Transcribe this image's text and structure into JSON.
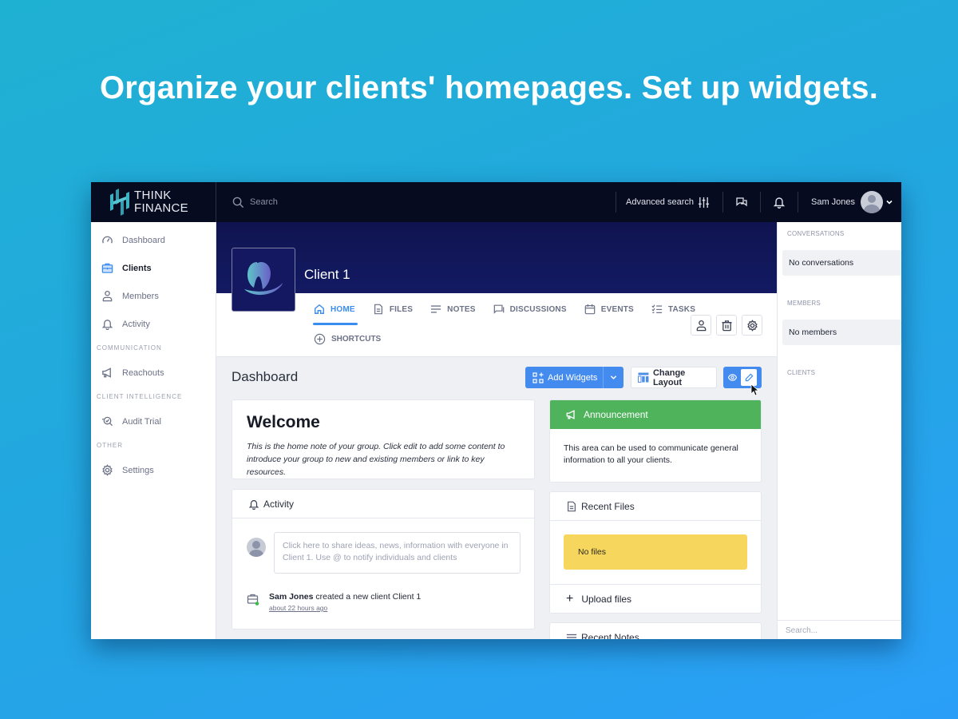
{
  "headline": "Organize your clients' homepages. Set up widgets.",
  "topbar": {
    "brand_line1": "THINK",
    "brand_line2": "FINANCE",
    "search_placeholder": "Search",
    "advanced_search_label": "Advanced search",
    "user_name": "Sam Jones",
    "icons": [
      "sliders-icon",
      "chat-icon",
      "bell-icon",
      "avatar",
      "chevron-down-icon"
    ]
  },
  "sidebar": {
    "items": [
      {
        "label": "Dashboard",
        "icon": "speedometer-icon",
        "active": false
      },
      {
        "label": "Clients",
        "icon": "briefcase-icon",
        "active": true
      },
      {
        "label": "Members",
        "icon": "user-icon",
        "active": false
      },
      {
        "label": "Activity",
        "icon": "bell-icon",
        "active": false
      }
    ],
    "sections": [
      {
        "title": "COMMUNICATION",
        "items": [
          {
            "label": "Reachouts",
            "icon": "megaphone-icon"
          }
        ]
      },
      {
        "title": "CLIENT INTELLIGENCE",
        "items": [
          {
            "label": "Audit Trial",
            "icon": "audit-search-icon"
          }
        ]
      },
      {
        "title": "OTHER",
        "items": [
          {
            "label": "Settings",
            "icon": "gear-icon"
          }
        ]
      }
    ]
  },
  "client": {
    "name": "Client 1",
    "tabs": [
      {
        "label": "HOME",
        "icon": "home-icon",
        "active": true
      },
      {
        "label": "FILES",
        "icon": "file-icon",
        "active": false
      },
      {
        "label": "NOTES",
        "icon": "notes-icon",
        "active": false
      },
      {
        "label": "DISCUSSIONS",
        "icon": "discussion-icon",
        "active": false
      },
      {
        "label": "EVENTS",
        "icon": "calendar-icon",
        "active": false
      },
      {
        "label": "TASKS",
        "icon": "tasks-icon",
        "active": false
      }
    ],
    "shortcuts_label": "SHORTCUTS"
  },
  "dashboard": {
    "title": "Dashboard",
    "add_widgets_label": "Add Widgets",
    "change_layout_label": "Change Layout"
  },
  "welcome": {
    "title": "Welcome",
    "body": "This is the home note of your group. Click edit to add some content to introduce your group to new and existing members or link to key resources."
  },
  "activity": {
    "title": "Activity",
    "input_placeholder": "Click here to share ideas, news, information with everyone in Client 1. Use @ to notify individuals and clients",
    "feed": [
      {
        "actor": "Sam Jones",
        "action": " created a new client Client 1",
        "time": "about 22 hours ago"
      }
    ]
  },
  "announcement": {
    "title": "Announcement",
    "body": "This area can be used to communicate general information to all your clients.",
    "color": "#4fb35c"
  },
  "recent_files": {
    "title": "Recent Files",
    "empty_label": "No files",
    "upload_label": "Upload files"
  },
  "recent_notes": {
    "title": "Recent Notes"
  },
  "right_panel": {
    "conversations_label": "CONVERSATIONS",
    "conversations_empty": "No conversations",
    "members_label": "MEMBERS",
    "members_empty": "No members",
    "clients_label": "CLIENTS",
    "search_placeholder": "Search..."
  },
  "colors": {
    "accent": "#448bf0",
    "topbar": "#070b1f",
    "hero": "#141a63",
    "warning": "#f7d65e"
  }
}
